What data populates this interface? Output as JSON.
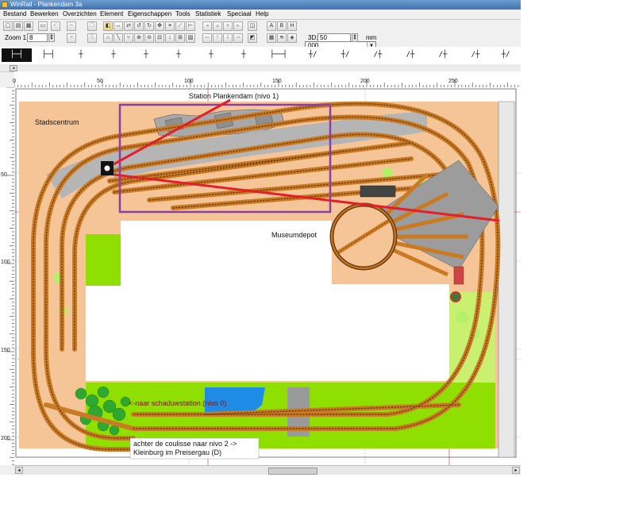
{
  "window": {
    "title": "WinRail - Plankendam 3a"
  },
  "menu": [
    "Bestand",
    "Bewerken",
    "Overzichten",
    "Element",
    "Eigenschappen",
    "Tools",
    "Statistiek",
    "Speciaal",
    "Help"
  ],
  "toolbar": {
    "zoom_label": "Zoom 1:",
    "zoom_value": "8",
    "layer_value": "000",
    "dim_3d_label": "3D:",
    "dim_3d_value": "50",
    "unit": "mm",
    "font_buttons": [
      "A",
      "B",
      "H"
    ]
  },
  "track_strip": {
    "items": [
      "├─┤",
      "├─┤",
      "┼",
      "┼",
      "┼",
      "┼",
      "┼",
      "┼",
      "├──┤",
      "┼/",
      "┼/",
      "/┼",
      "/┼",
      "/┼",
      "/┼",
      "┼/"
    ],
    "selected_index": 0
  },
  "ruler": {
    "x_labels": [
      "0",
      "50",
      "100",
      "150",
      "200",
      "250"
    ],
    "y_labels": [
      "50",
      "100",
      "150",
      "200"
    ]
  },
  "layout": {
    "labels": {
      "station": "Station Plankendam (nivo 1)",
      "city": "Stadscentrum",
      "museum": "Museumdepot",
      "shadow": "<-naar schaduwstation (nivo 0)",
      "coulisse_line1": "achter de coulisse  naar nivo 2 ->",
      "coulisse_line2": "Kleinburg im Preisergau (D)"
    },
    "colors": {
      "baseboard": "#f6c597",
      "grass": "#8fe000",
      "water": "#1e8ce6",
      "rail": "#c97a22",
      "sleeper": "#6b3a10",
      "station_area": "#b5b5b5",
      "highlight_box": "#8b3fa6",
      "annotation_line": "#e41e2b",
      "trees": "#2ea82e"
    }
  }
}
